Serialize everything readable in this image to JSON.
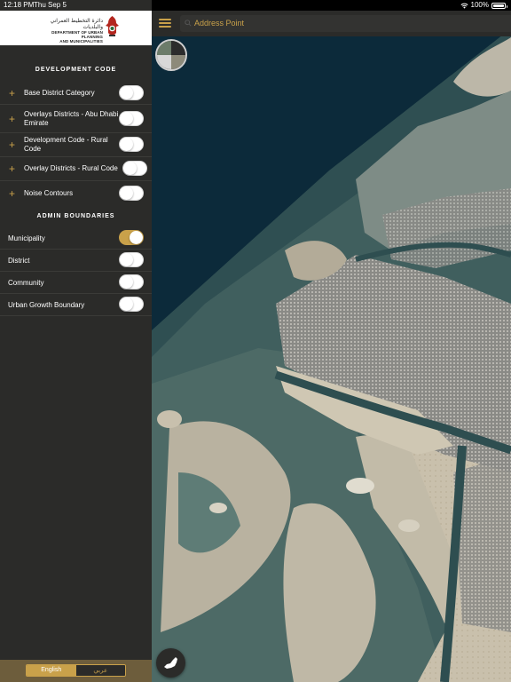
{
  "status_bar": {
    "time": "12:18 PM",
    "date": "Thu Sep 5",
    "battery_text": "100%",
    "battery_level": 1.0
  },
  "logo": {
    "arabic_line": "دائرة التخطيط العمراني والبلديات",
    "english_line1": "DEPARTMENT OF URBAN PLANNING",
    "english_line2": "AND MUNICIPALITIES"
  },
  "sidebar": {
    "development_code_title": "DEVELOPMENT CODE",
    "development_layers": [
      {
        "label": "Base District Category",
        "on": false,
        "icon": "plus-icon"
      },
      {
        "label": "Overlays Districts - Abu Dhabi Emirate",
        "on": false,
        "icon": "plus-icon"
      },
      {
        "label": "Development Code - Rural Code",
        "on": false,
        "icon": "plus-icon"
      },
      {
        "label": "Overlay Districts - Rural Code",
        "on": false,
        "icon": "plus-icon"
      },
      {
        "label": "Noise Contours",
        "on": false,
        "icon": "plus-icon"
      }
    ],
    "admin_boundaries_title": "ADMIN BOUNDARIES",
    "admin_layers": [
      {
        "label": "Municipality",
        "on": true
      },
      {
        "label": "District",
        "on": false
      },
      {
        "label": "Community",
        "on": false
      },
      {
        "label": "Urban Growth Boundary",
        "on": false
      }
    ]
  },
  "language": {
    "english": "English",
    "arabic": "عربي",
    "selected": "English"
  },
  "search": {
    "placeholder": "Address Point",
    "icon": "search-icon"
  },
  "colors": {
    "accent": "#c9a14a",
    "sidebar_bg": "#2b2b29",
    "water": "#0c2a3a"
  }
}
